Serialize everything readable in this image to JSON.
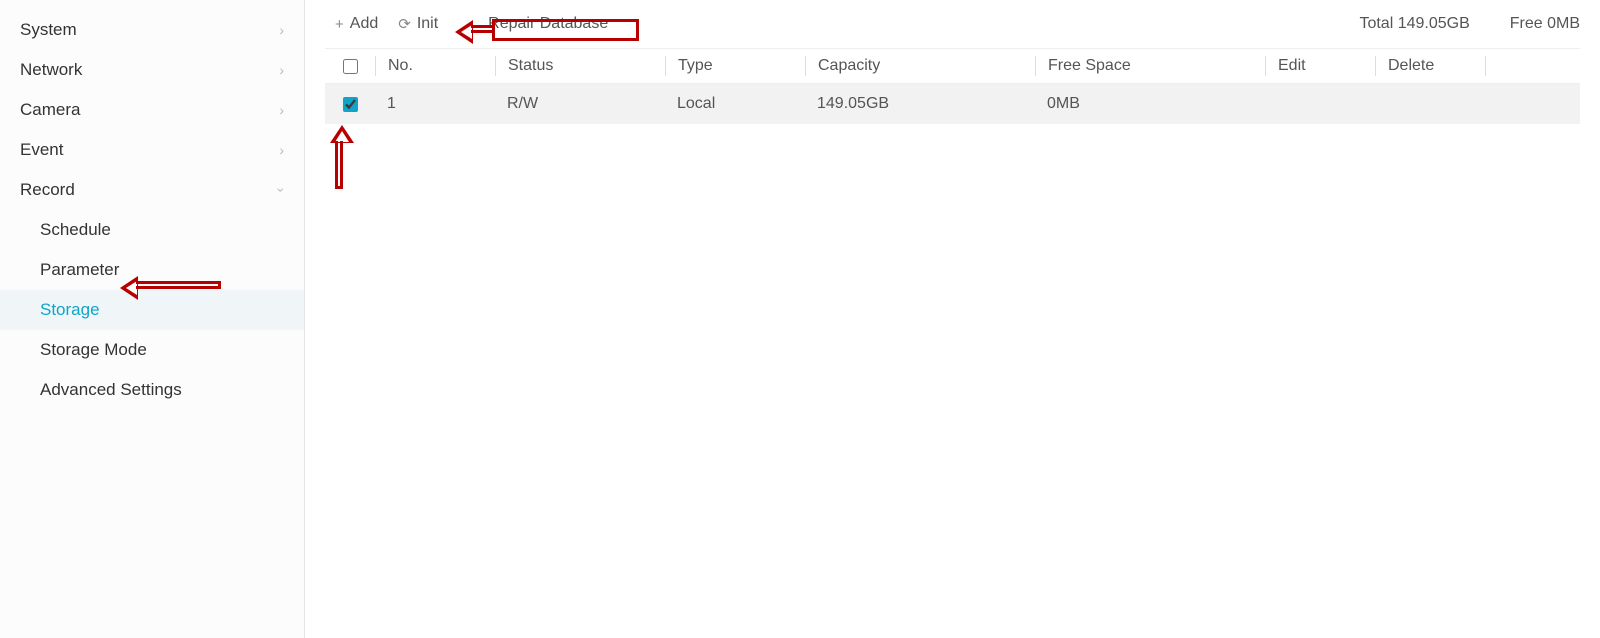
{
  "sidebar": {
    "items": [
      {
        "label": "System",
        "expanded": false
      },
      {
        "label": "Network",
        "expanded": false
      },
      {
        "label": "Camera",
        "expanded": false
      },
      {
        "label": "Event",
        "expanded": false
      },
      {
        "label": "Record",
        "expanded": true
      }
    ],
    "record_children": [
      {
        "label": "Schedule",
        "active": false
      },
      {
        "label": "Parameter",
        "active": false
      },
      {
        "label": "Storage",
        "active": true
      },
      {
        "label": "Storage Mode",
        "active": false
      },
      {
        "label": "Advanced Settings",
        "active": false
      }
    ]
  },
  "toolbar": {
    "add_label": "Add",
    "init_label": "Init",
    "repair_label": "Repair Database",
    "total_label": "Total 149.05GB",
    "free_label": "Free 0MB"
  },
  "table": {
    "headers": {
      "no": "No.",
      "status": "Status",
      "type": "Type",
      "capacity": "Capacity",
      "free": "Free Space",
      "edit": "Edit",
      "delete": "Delete"
    },
    "rows": [
      {
        "checked": true,
        "no": "1",
        "status": "R/W",
        "type": "Local",
        "capacity": "149.05GB",
        "free": "0MB"
      }
    ]
  }
}
